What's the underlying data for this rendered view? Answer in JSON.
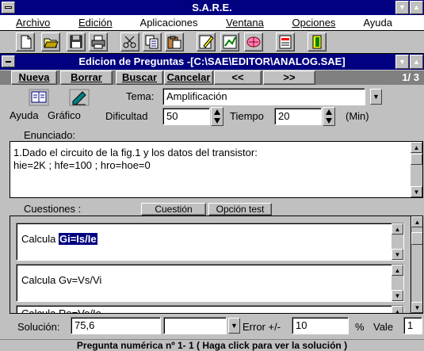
{
  "app": {
    "title": "S.A.R.E."
  },
  "menu": [
    "Archivo",
    "Edición",
    "Aplicaciones",
    "Ventana",
    "Opciones",
    "Ayuda"
  ],
  "toolbar": {
    "icons": [
      "new-document-icon",
      "open-folder-icon",
      "save-disk-icon",
      "print-icon",
      "cut-scissors-icon",
      "copy-icon",
      "paste-icon",
      "edit-pencil-icon",
      "chart-icon",
      "brain-icon",
      "report-icon",
      "exit-door-icon"
    ]
  },
  "child_window": {
    "title": "Edicion de Preguntas -[C:\\SAE\\EDITOR\\ANALOG.SAE]",
    "nav": {
      "nueva": "Nueva",
      "borrar": "Borrar",
      "buscar": "Buscar",
      "cancelar": "Cancelar",
      "prev": "<<",
      "next": ">>",
      "page": "1/ 3"
    }
  },
  "form": {
    "ayuda_label": "Ayuda",
    "grafico_label": "Gráfico",
    "tema_label": "Tema:",
    "tema_value": "Amplificación",
    "dificultad_label": "Dificultad",
    "dificultad_value": "50",
    "tiempo_label": "Tiempo",
    "tiempo_value": "20",
    "tiempo_unit": "(Min)"
  },
  "enunciado": {
    "label": "Enunciado:",
    "line1": "1.Dado el circuito de la fig.1 y los datos del transistor:",
    "line2": "hie=2K ; hfe=100 ; hro=hoe=0"
  },
  "cuestiones": {
    "label": "Cuestiones :",
    "cuestion_button": "Cuestión",
    "opcion_test_button": "Opción test",
    "items": [
      {
        "prefix": "Calcula",
        "selected": "Gi=Is/Ie"
      },
      {
        "text": "Calcula Gv=Vs/Vi"
      },
      {
        "text": "Calcula Re=Ve/Ie"
      }
    ]
  },
  "solucion": {
    "label": "Solución:",
    "value": "75,6",
    "unit_value": "",
    "error_label": "Error +/-",
    "error_value": "10",
    "percent": "%",
    "vale_label": "Vale",
    "vale_value": "1"
  },
  "status": {
    "text": "Pregunta numérica nº 1- 1 ( Haga click para ver la solución )"
  }
}
